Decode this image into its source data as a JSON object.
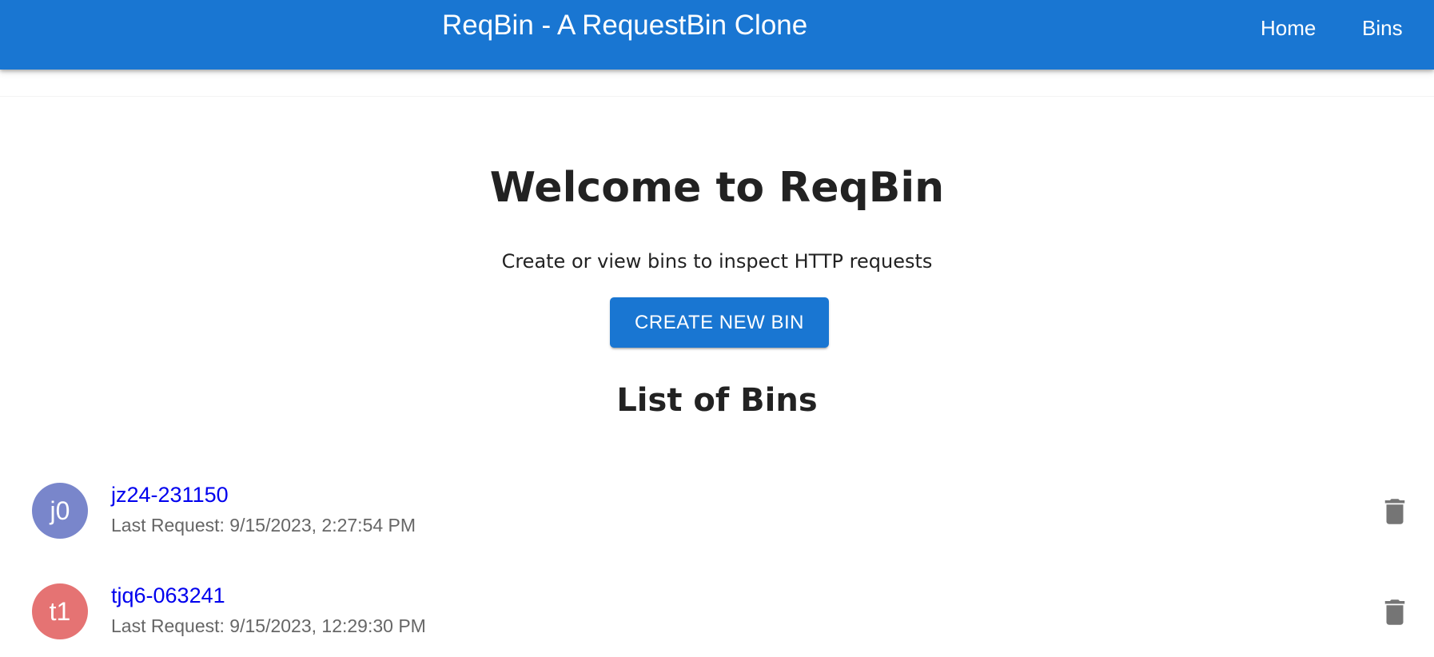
{
  "header": {
    "title": "ReqBin - A RequestBin Clone",
    "nav": [
      {
        "label": "Home"
      },
      {
        "label": "Bins"
      }
    ],
    "color": "#1976d2"
  },
  "main": {
    "welcome": "Welcome to ReqBin",
    "subtitle": "Create or view bins to inspect HTTP requests",
    "create_button_label": "CREATE NEW BIN",
    "list_heading": "List of Bins"
  },
  "bins": [
    {
      "avatar_text": "j0",
      "avatar_color": "#7986cb",
      "name": "jz24-231150",
      "last_request": "Last Request: 9/15/2023, 2:27:54 PM",
      "delete_icon": "trash-icon"
    },
    {
      "avatar_text": "t1",
      "avatar_color": "#e57373",
      "name": "tjq6-063241",
      "last_request": "Last Request: 9/15/2023, 12:29:30 PM",
      "delete_icon": "trash-icon"
    }
  ]
}
